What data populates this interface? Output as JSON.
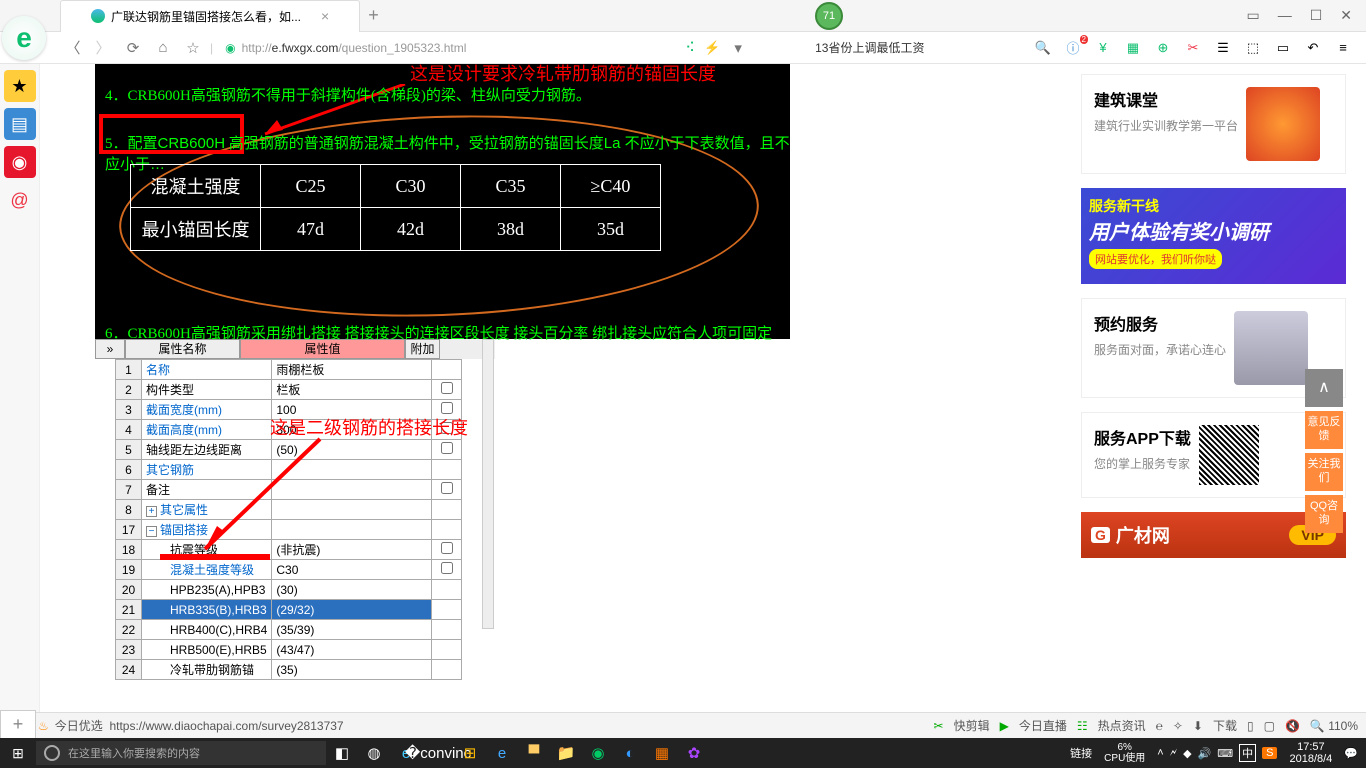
{
  "tab": {
    "title": "广联达钢筋里锚固搭接怎么看，如...",
    "badge": "71"
  },
  "addr": {
    "url_pre": "http://",
    "url_host": "e.fwxgx.com",
    "url_path": "/question_1905323.html",
    "news": "13省份上调最低工资"
  },
  "cad": {
    "anno1": "这是设计要求冷轧带肋钢筋的锚固长度",
    "line4": "4．CRB600H高强钢筋不得用于斜撑构件(含梯段)的梁、柱纵向受力钢筋。",
    "line5_box": "配置CRB600H",
    "line5_rest": "高强钢筋的普通钢筋混凝土构件中，受拉钢筋的锚固长度La 不应小于下表数值，且不应小于…",
    "headers": [
      "混凝土强度",
      "C25",
      "C30",
      "C35",
      "≥C40"
    ],
    "row2": [
      "最小锚固长度",
      "47d",
      "42d",
      "38d",
      "35d"
    ],
    "line6": "6．CRB600H高强钢筋采用绑扎搭接 搭接接头的连接区段长度 接头百分率 绑扎接头应符合人项可固定"
  },
  "gridHeader": {
    "c1": "",
    "c2": "属性名称",
    "c3": "属性值",
    "c4": "附加"
  },
  "gridRows": [
    {
      "n": "1",
      "name": "名称",
      "val": "雨棚栏板",
      "blue": true
    },
    {
      "n": "2",
      "name": "构件类型",
      "val": "栏板",
      "ck": true
    },
    {
      "n": "3",
      "name": "截面宽度(mm)",
      "val": "100",
      "blue": true,
      "ck": true
    },
    {
      "n": "4",
      "name": "截面高度(mm)",
      "val": "300",
      "blue": true,
      "ck": true
    },
    {
      "n": "5",
      "name": "轴线距左边线距离",
      "val": "(50)",
      "ck": true
    },
    {
      "n": "6",
      "name": "其它钢筋",
      "val": "",
      "blue": true
    },
    {
      "n": "7",
      "name": "备注",
      "val": "",
      "ck": true
    },
    {
      "n": "8",
      "name": "其它属性",
      "val": "",
      "exp": "+",
      "blue": true
    },
    {
      "n": "17",
      "name": "锚固搭接",
      "val": "",
      "exp": "−",
      "blue": true
    },
    {
      "n": "18",
      "name": "抗震等级",
      "val": "(非抗震)",
      "ind": 2,
      "ck": true
    },
    {
      "n": "19",
      "name": "混凝土强度等级",
      "val": "C30",
      "ind": 2,
      "blue": true,
      "ck": true
    },
    {
      "n": "20",
      "name": "HPB235(A),HPB3",
      "val": "(30)",
      "ind": 2
    },
    {
      "n": "21",
      "name": "HRB335(B),HRB3",
      "val": "(29/32)",
      "ind": 2,
      "sel": true
    },
    {
      "n": "22",
      "name": "HRB400(C),HRB4",
      "val": "(35/39)",
      "ind": 2
    },
    {
      "n": "23",
      "name": "HRB500(E),HRB5",
      "val": "(43/47)",
      "ind": 2
    },
    {
      "n": "24",
      "name": "冷轧带肋钢筋锚",
      "val": "(35)",
      "ind": 2
    }
  ],
  "anno2": "这是二级钢筋的搭接长度",
  "side": {
    "c1": {
      "title": "建筑课堂",
      "desc": "建筑行业实训教学第一平台"
    },
    "banner": {
      "l1": "服务新干线",
      "l2": "用户体验有奖小调研",
      "l3": "网站要优化，我们听你哒"
    },
    "c2": {
      "title": "预约服务",
      "desc": "服务面对面，承诺心连心"
    },
    "c3": {
      "title": "服务APP下载",
      "desc": "您的掌上服务专家"
    },
    "vip": {
      "name": "广材网",
      "btn": "VIP"
    }
  },
  "float": {
    "top": "∧",
    "b1": "意见反馈",
    "b2": "关注我们",
    "b3": "QQ咨询"
  },
  "status": {
    "label": "今日优选",
    "url": "https://www.diaochapai.com/survey2813737",
    "r1": "快剪辑",
    "r2": "今日直播",
    "r3": "热点资讯",
    "dl": "下载",
    "zoom": "110%"
  },
  "taskbar": {
    "search": "在这里输入你要搜索的内容",
    "link": "链接",
    "cpu1": "6%",
    "cpu2": "CPU使用",
    "ime": "中",
    "sogou": "S",
    "time": "17:57",
    "date": "2018/8/4"
  }
}
